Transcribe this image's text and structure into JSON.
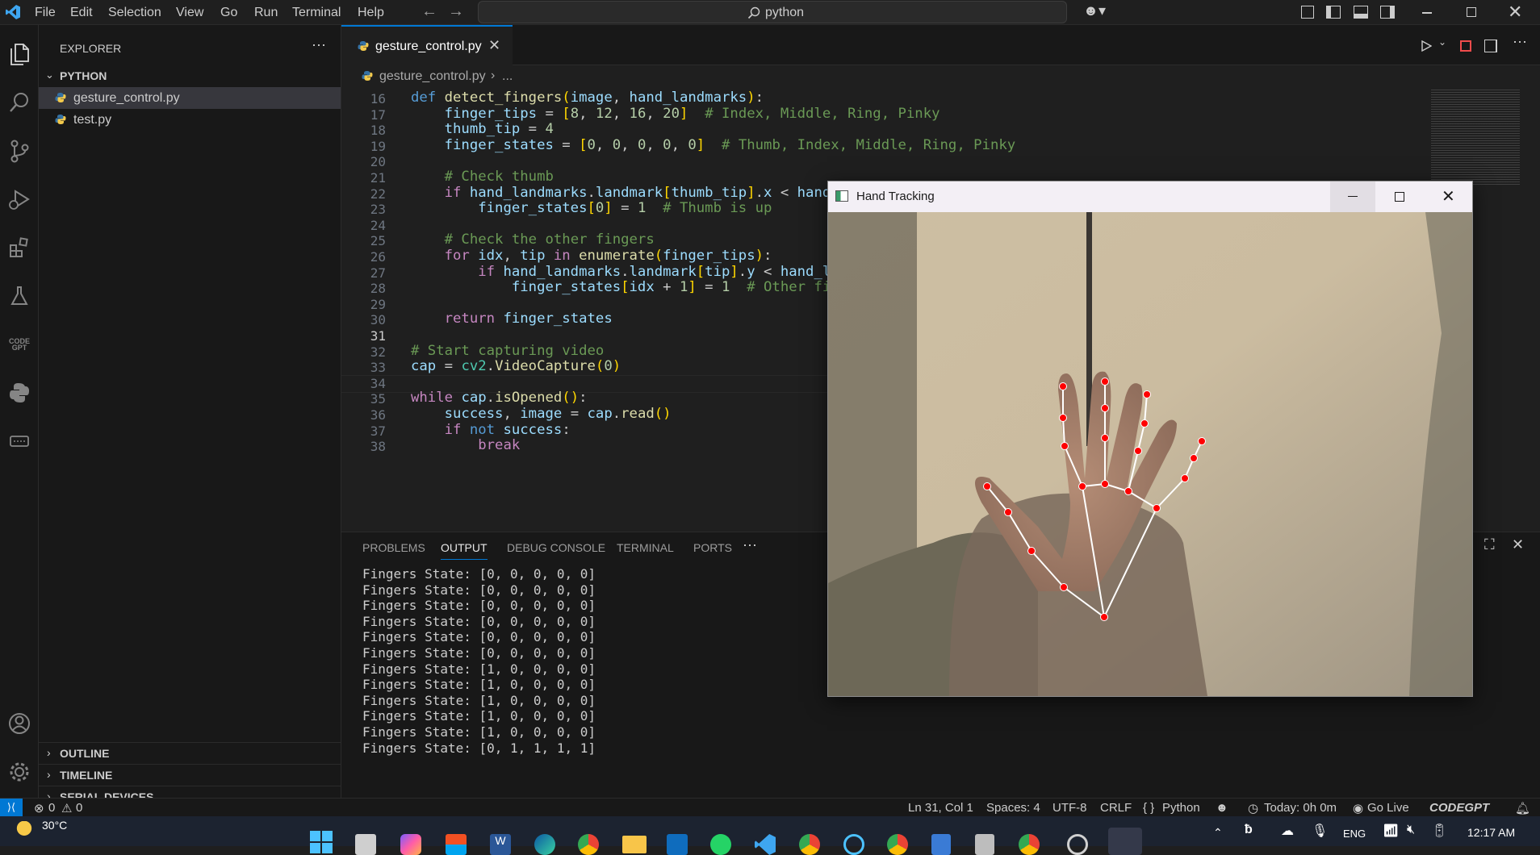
{
  "menu": [
    "File",
    "Edit",
    "Selection",
    "View",
    "Go",
    "Run",
    "Terminal",
    "Help"
  ],
  "search": {
    "text": "python"
  },
  "sidebar": {
    "title": "EXPLORER",
    "folder": "PYTHON",
    "files": [
      "gesture_control.py",
      "test.py"
    ],
    "sections": [
      "OUTLINE",
      "TIMELINE",
      "SERIAL DEVICES"
    ]
  },
  "editor": {
    "tab": "gesture_control.py",
    "breadcrumb_file": "gesture_control.py",
    "breadcrumb_rest": "...",
    "line_numbers": [
      "16",
      "17",
      "18",
      "19",
      "20",
      "21",
      "22",
      "23",
      "24",
      "25",
      "26",
      "27",
      "28",
      "29",
      "30",
      "31",
      "32",
      "33",
      "34",
      "35",
      "36",
      "37",
      "38"
    ]
  },
  "panel": {
    "tabs": [
      "PROBLEMS",
      "OUTPUT",
      "DEBUG CONSOLE",
      "TERMINAL",
      "PORTS"
    ],
    "output_lines": [
      "Fingers State: [0, 0, 0, 0, 0]",
      "Fingers State: [0, 0, 0, 0, 0]",
      "Fingers State: [0, 0, 0, 0, 0]",
      "Fingers State: [0, 0, 0, 0, 0]",
      "Fingers State: [0, 0, 0, 0, 0]",
      "Fingers State: [0, 0, 0, 0, 0]",
      "Fingers State: [1, 0, 0, 0, 0]",
      "Fingers State: [1, 0, 0, 0, 0]",
      "Fingers State: [1, 0, 0, 0, 0]",
      "Fingers State: [1, 0, 0, 0, 0]",
      "Fingers State: [1, 0, 0, 0, 0]",
      "Fingers State: [0, 1, 1, 1, 1]"
    ]
  },
  "status": {
    "errors": "0",
    "warnings": "0",
    "position": "Ln 31, Col 1",
    "spaces": "Spaces: 4",
    "encoding": "UTF-8",
    "eol": "CRLF",
    "language": "Python",
    "today": "Today: 0h 0m",
    "golive": "Go Live",
    "codegpt": "CODEGPT"
  },
  "hand_window": {
    "title": "Hand Tracking"
  },
  "taskbar": {
    "weather_temp": "30°C",
    "lang": "ENG",
    "time": "12:17 AM"
  },
  "colors": {
    "accent": "#0078d4",
    "landmark": "#ff0000",
    "connection": "#ffffff"
  }
}
